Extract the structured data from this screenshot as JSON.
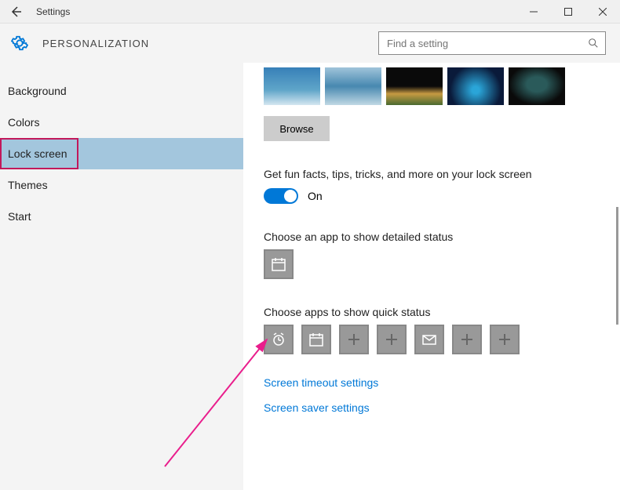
{
  "window": {
    "title": "Settings"
  },
  "header": {
    "section": "PERSONALIZATION",
    "searchPlaceholder": "Find a setting"
  },
  "sidebar": {
    "items": [
      {
        "label": "Background"
      },
      {
        "label": "Colors"
      },
      {
        "label": "Lock screen"
      },
      {
        "label": "Themes"
      },
      {
        "label": "Start"
      }
    ]
  },
  "content": {
    "browseLabel": "Browse",
    "funFactsLabel": "Get fun facts, tips, tricks, and more on your lock screen",
    "toggleState": "On",
    "detailedStatusLabel": "Choose an app to show detailed status",
    "quickStatusLabel": "Choose apps to show quick status",
    "link1": "Screen timeout settings",
    "link2": "Screen saver settings"
  }
}
